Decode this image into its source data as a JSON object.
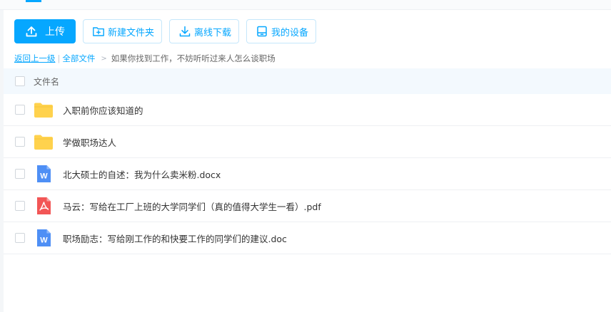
{
  "toolbar": {
    "upload_label": "上传",
    "new_folder_label": "新建文件夹",
    "offline_download_label": "离线下载",
    "my_devices_label": "我的设备"
  },
  "breadcrumb": {
    "back_label": "返回上一级",
    "root_label": "全部文件",
    "current_label": "如果你找到工作，不妨听听过来人怎么谈职场"
  },
  "list": {
    "header_name": "文件名",
    "files": [
      {
        "name": "入职前你应该知道的",
        "type": "folder"
      },
      {
        "name": "学做职场达人",
        "type": "folder"
      },
      {
        "name": "北大硕士的自述：我为什么卖米粉.docx",
        "type": "word"
      },
      {
        "name": "马云：写给在工厂上班的大学同学们（真的值得大学生一看）.pdf",
        "type": "pdf"
      },
      {
        "name": "职场励志：写给刚工作的和快要工作的同学们的建议.doc",
        "type": "word"
      }
    ]
  },
  "colors": {
    "accent": "#06a7ff",
    "folder": "#ffd24d",
    "word": "#4e8ff5",
    "pdf": "#f25656"
  },
  "icons": {
    "upload": "upload-icon",
    "new_folder": "folder-plus-icon",
    "offline_download": "download-icon",
    "devices": "device-icon",
    "folder": "folder-icon",
    "word": "word-doc-icon",
    "pdf": "pdf-doc-icon"
  }
}
